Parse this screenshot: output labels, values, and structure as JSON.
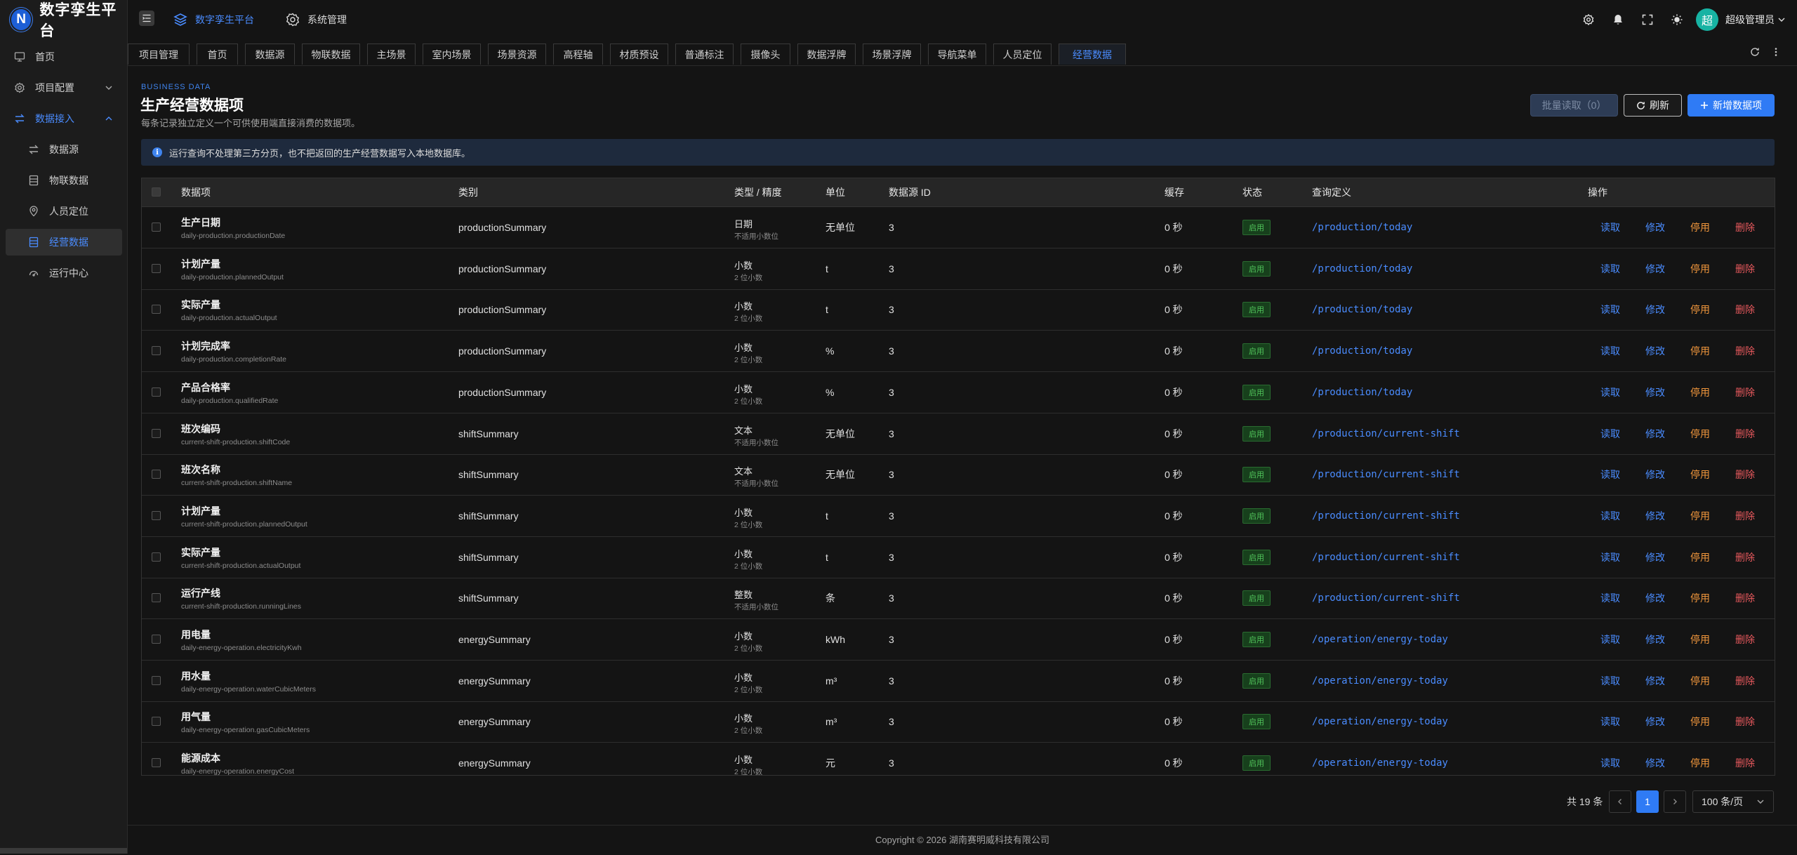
{
  "app": {
    "logo_letter": "N",
    "title": "数字孪生平台"
  },
  "sidebar": {
    "items": [
      {
        "label": "首页",
        "icon": "monitor-icon"
      },
      {
        "label": "项目配置",
        "icon": "gear-icon"
      },
      {
        "label": "数据接入",
        "icon": "swap-icon"
      },
      {
        "label": "数据源",
        "icon": "swap-icon"
      },
      {
        "label": "物联数据",
        "icon": "database-icon"
      },
      {
        "label": "人员定位",
        "icon": "location-icon"
      },
      {
        "label": "经营数据",
        "icon": "database-icon"
      },
      {
        "label": "运行中心",
        "icon": "dashboard-icon"
      }
    ]
  },
  "header": {
    "nav": [
      {
        "label": "数字孪生平台",
        "icon": "layers-icon"
      },
      {
        "label": "系统管理",
        "icon": "gear-icon"
      }
    ],
    "avatar_char": "超",
    "user_name": "超级管理员",
    "icons": [
      "settings-icon",
      "bell-icon",
      "fullscreen-icon",
      "theme-icon"
    ]
  },
  "tabs": [
    "项目管理",
    "首页",
    "数据源",
    "物联数据",
    "主场景",
    "室内场景",
    "场景资源",
    "高程轴",
    "材质预设",
    "普通标注",
    "摄像头",
    "数据浮牌",
    "场景浮牌",
    "导航菜单",
    "人员定位",
    "经营数据"
  ],
  "active_tab": "经营数据",
  "page": {
    "eyebrow": "BUSINESS DATA",
    "title": "生产经营数据项",
    "desc": "每条记录独立定义一个可供使用端直接消费的数据项。",
    "btn_batch": "批量读取（0）",
    "btn_refresh": "刷新",
    "btn_add": "新增数据项",
    "notice": "运行查询不处理第三方分页，也不把返回的生产经营数据写入本地数据库。"
  },
  "table": {
    "headers": {
      "name": "数据项",
      "category": "类别",
      "type": "类型 / 精度",
      "unit": "单位",
      "source": "数据源 ID",
      "cache": "缓存",
      "status": "状态",
      "query": "查询定义",
      "ops": "操作"
    },
    "actions": {
      "read": "读取",
      "edit": "修改",
      "stop": "停用",
      "del": "删除"
    },
    "rows": [
      {
        "name": "生产日期",
        "key": "daily-production.productionDate",
        "category": "productionSummary",
        "type": "日期",
        "precision": "不适用小数位",
        "unit": "无单位",
        "source": "3",
        "cache": "0 秒",
        "status": "启用",
        "query": "/production/today"
      },
      {
        "name": "计划产量",
        "key": "daily-production.plannedOutput",
        "category": "productionSummary",
        "type": "小数",
        "precision": "2 位小数",
        "unit": "t",
        "source": "3",
        "cache": "0 秒",
        "status": "启用",
        "query": "/production/today"
      },
      {
        "name": "实际产量",
        "key": "daily-production.actualOutput",
        "category": "productionSummary",
        "type": "小数",
        "precision": "2 位小数",
        "unit": "t",
        "source": "3",
        "cache": "0 秒",
        "status": "启用",
        "query": "/production/today"
      },
      {
        "name": "计划完成率",
        "key": "daily-production.completionRate",
        "category": "productionSummary",
        "type": "小数",
        "precision": "2 位小数",
        "unit": "%",
        "source": "3",
        "cache": "0 秒",
        "status": "启用",
        "query": "/production/today"
      },
      {
        "name": "产品合格率",
        "key": "daily-production.qualifiedRate",
        "category": "productionSummary",
        "type": "小数",
        "precision": "2 位小数",
        "unit": "%",
        "source": "3",
        "cache": "0 秒",
        "status": "启用",
        "query": "/production/today"
      },
      {
        "name": "班次编码",
        "key": "current-shift-production.shiftCode",
        "category": "shiftSummary",
        "type": "文本",
        "precision": "不适用小数位",
        "unit": "无单位",
        "source": "3",
        "cache": "0 秒",
        "status": "启用",
        "query": "/production/current-shift"
      },
      {
        "name": "班次名称",
        "key": "current-shift-production.shiftName",
        "category": "shiftSummary",
        "type": "文本",
        "precision": "不适用小数位",
        "unit": "无单位",
        "source": "3",
        "cache": "0 秒",
        "status": "启用",
        "query": "/production/current-shift"
      },
      {
        "name": "计划产量",
        "key": "current-shift-production.plannedOutput",
        "category": "shiftSummary",
        "type": "小数",
        "precision": "2 位小数",
        "unit": "t",
        "source": "3",
        "cache": "0 秒",
        "status": "启用",
        "query": "/production/current-shift"
      },
      {
        "name": "实际产量",
        "key": "current-shift-production.actualOutput",
        "category": "shiftSummary",
        "type": "小数",
        "precision": "2 位小数",
        "unit": "t",
        "source": "3",
        "cache": "0 秒",
        "status": "启用",
        "query": "/production/current-shift"
      },
      {
        "name": "运行产线",
        "key": "current-shift-production.runningLines",
        "category": "shiftSummary",
        "type": "整数",
        "precision": "不适用小数位",
        "unit": "条",
        "source": "3",
        "cache": "0 秒",
        "status": "启用",
        "query": "/production/current-shift"
      },
      {
        "name": "用电量",
        "key": "daily-energy-operation.electricityKwh",
        "category": "energySummary",
        "type": "小数",
        "precision": "2 位小数",
        "unit": "kWh",
        "source": "3",
        "cache": "0 秒",
        "status": "启用",
        "query": "/operation/energy-today"
      },
      {
        "name": "用水量",
        "key": "daily-energy-operation.waterCubicMeters",
        "category": "energySummary",
        "type": "小数",
        "precision": "2 位小数",
        "unit": "m³",
        "source": "3",
        "cache": "0 秒",
        "status": "启用",
        "query": "/operation/energy-today"
      },
      {
        "name": "用气量",
        "key": "daily-energy-operation.gasCubicMeters",
        "category": "energySummary",
        "type": "小数",
        "precision": "2 位小数",
        "unit": "m³",
        "source": "3",
        "cache": "0 秒",
        "status": "启用",
        "query": "/operation/energy-today"
      },
      {
        "name": "能源成本",
        "key": "daily-energy-operation.energyCost",
        "category": "energySummary",
        "type": "小数",
        "precision": "2 位小数",
        "unit": "元",
        "source": "3",
        "cache": "0 秒",
        "status": "启用",
        "query": "/operation/energy-today"
      }
    ]
  },
  "pagination": {
    "total": "共 19 条",
    "current": "1",
    "page_size": "100 条/页"
  },
  "footer": "Copyright © 2026 湖南赛明威科技有限公司",
  "colors": {
    "accent": "#2f7bf5",
    "link": "#4a8cff",
    "warning": "#f0963c",
    "danger": "#e8595d",
    "success": "#50c25a"
  }
}
